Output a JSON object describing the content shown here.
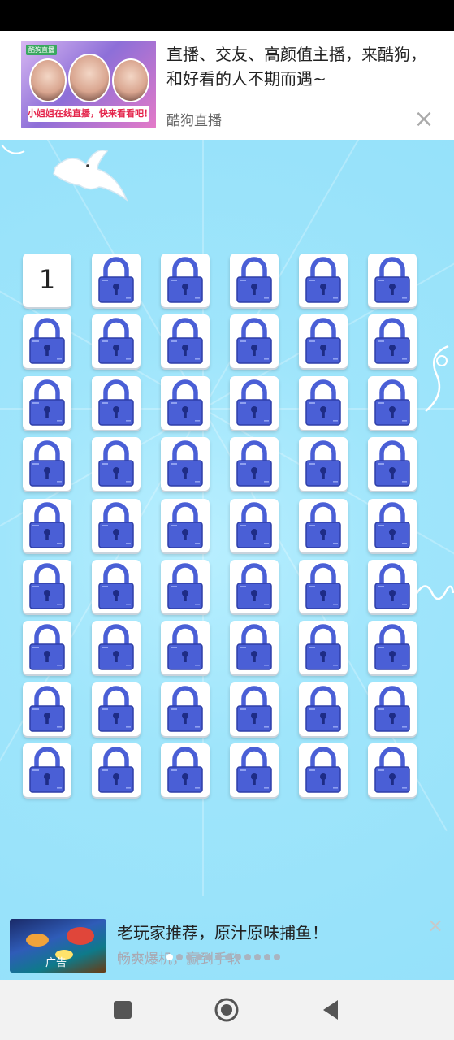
{
  "top_ad": {
    "title": "直播、交友、高颜值主播，来酷狗，和好看的人不期而遇~",
    "source": "酷狗直播",
    "banner_text": "小姐姐在线直播，快来看看吧！",
    "brand_tag": "酷狗直播",
    "close_symbol": "×"
  },
  "game": {
    "columns": 6,
    "rows": 9,
    "unlocked_levels": [
      "1"
    ],
    "lock_color": "#4a5fd6",
    "background_color": "#97e2fa"
  },
  "bottom_ad": {
    "title": "老玩家推荐，原汁原味捕鱼！",
    "subtitle": "畅爽爆机，赢到手软",
    "ad_label": "广告",
    "close_symbol": "×",
    "carousel": {
      "count": 12,
      "active_index": 0
    }
  },
  "navbar": {
    "buttons": [
      "recent-apps",
      "home",
      "back"
    ]
  }
}
